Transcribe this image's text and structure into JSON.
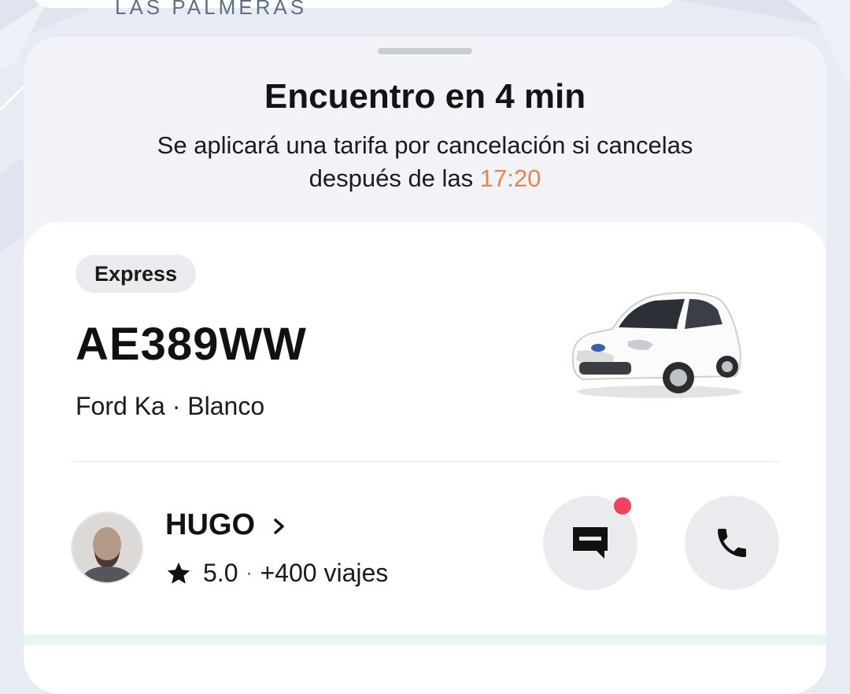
{
  "map": {
    "label": "LAS PALMERAS"
  },
  "header": {
    "title": "Encuentro en 4 min",
    "subtitle_line1": "Se aplicará una tarifa por cancelación si cancelas",
    "subtitle_line2": "después de las",
    "cancel_time": "17:20"
  },
  "ride": {
    "service": "Express",
    "plate": "AE389WW",
    "vehicle": "Ford Ka · Blanco"
  },
  "driver": {
    "name": "HUGO",
    "rating": "5.0",
    "separator": "·",
    "trips": "+400 viajes"
  },
  "colors": {
    "accent_time": "#e8834a",
    "notification": "#f0435b",
    "button_bg": "#e9ebee"
  },
  "icons": [
    "chevron-right-icon",
    "star-icon",
    "message-icon",
    "phone-icon"
  ]
}
